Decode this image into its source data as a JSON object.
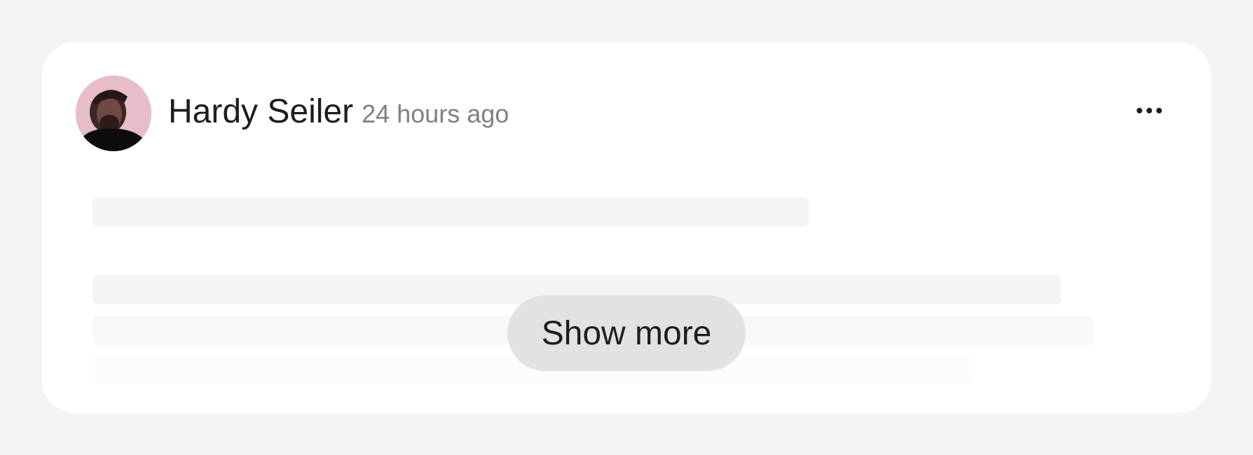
{
  "post": {
    "author": "Hardy Seiler",
    "timestamp": "24 hours ago",
    "avatar_icon": "user-avatar-photo",
    "menu_icon": "more-horizontal-icon"
  },
  "actions": {
    "show_more_label": "Show more"
  },
  "colors": {
    "page_background": "#f5f4f2",
    "card_background": "#ffffff",
    "skeleton": "#f5f4f2",
    "button_background": "#e3e2e1",
    "text_primary": "#1d1d1d",
    "text_secondary": "#808080"
  }
}
